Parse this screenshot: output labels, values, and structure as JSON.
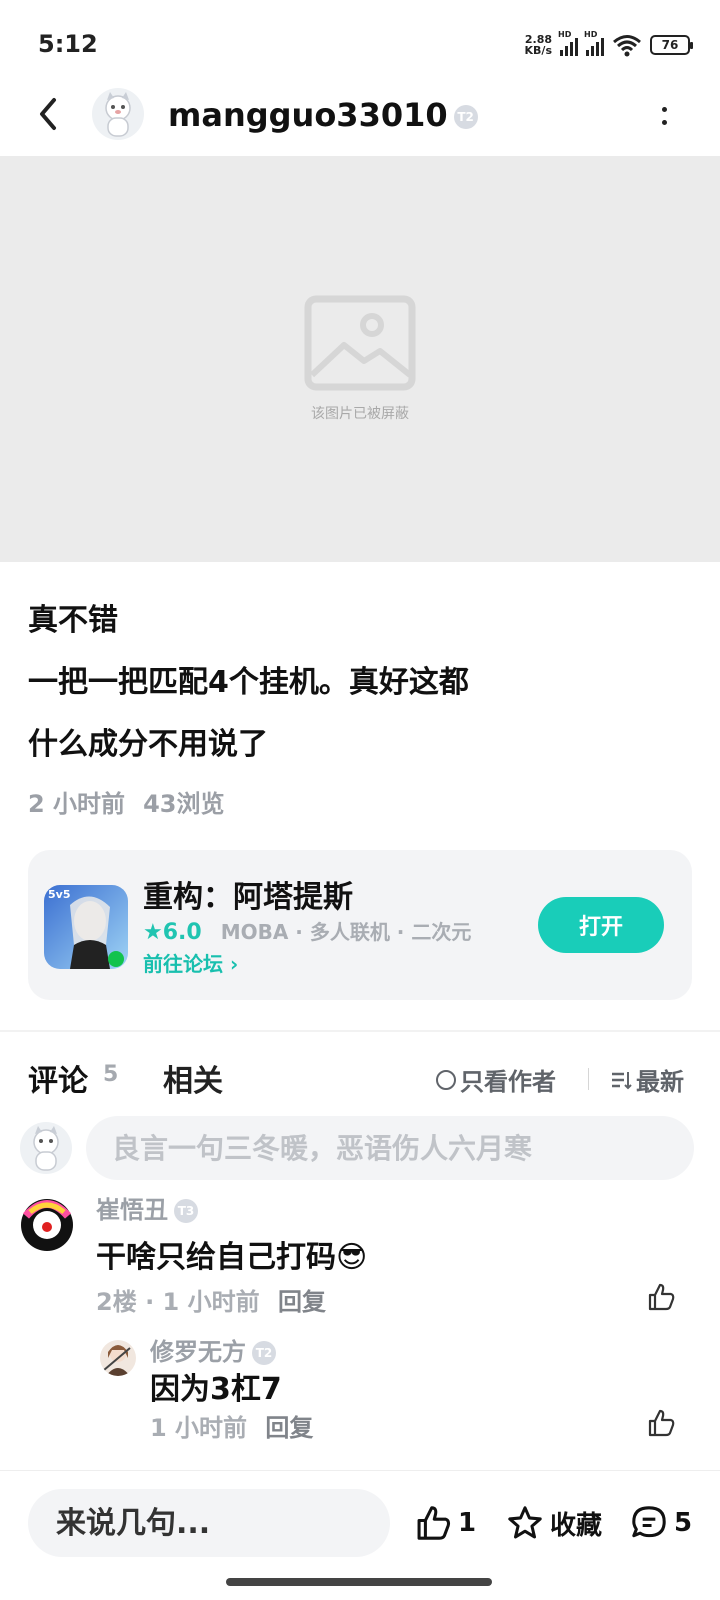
{
  "status_bar": {
    "time": "5:12",
    "net_speed_value": "2.88",
    "net_speed_unit": "KB/s",
    "network_tag": "HD",
    "battery": "76"
  },
  "header": {
    "username": "mangguo33010",
    "level": "T2"
  },
  "image": {
    "blocked_text": "该图片已被屏蔽"
  },
  "post": {
    "lines": [
      "真不错",
      "一把一把匹配4个挂机。真好这都",
      "什么成分不用说了"
    ],
    "time": "2 小时前",
    "views": "43浏览"
  },
  "game_card": {
    "title": "重构：阿塔提斯",
    "score": "6.0",
    "tags": "MOBA · 多人联机 · 二次元",
    "forum_link": "前往论坛",
    "open_button": "打开",
    "icon_badge": "5v5"
  },
  "tabs": {
    "comments_label": "评论",
    "comments_count": "5",
    "related_label": "相关",
    "author_only": "只看作者",
    "sort": "最新"
  },
  "comment_input": {
    "placeholder": "良言一句三冬暖，恶语伤人六月寒"
  },
  "comments": [
    {
      "name": "崔悟丑",
      "level": "T3",
      "text": "干啥只给自己打码😎",
      "floor": "2楼",
      "time": "1 小时前",
      "reply": "回复"
    },
    {
      "name": "修罗无方",
      "level": "T2",
      "text": "因为3杠7",
      "time": "1 小时前",
      "reply": "回复"
    }
  ],
  "bottom_bar": {
    "placeholder": "来说几句...",
    "likes": "1",
    "favorite": "收藏",
    "comment_count": "5"
  },
  "colors": {
    "accent": "#19cdb9",
    "muted": "#a9adb3",
    "card_bg": "#f3f4f6"
  }
}
